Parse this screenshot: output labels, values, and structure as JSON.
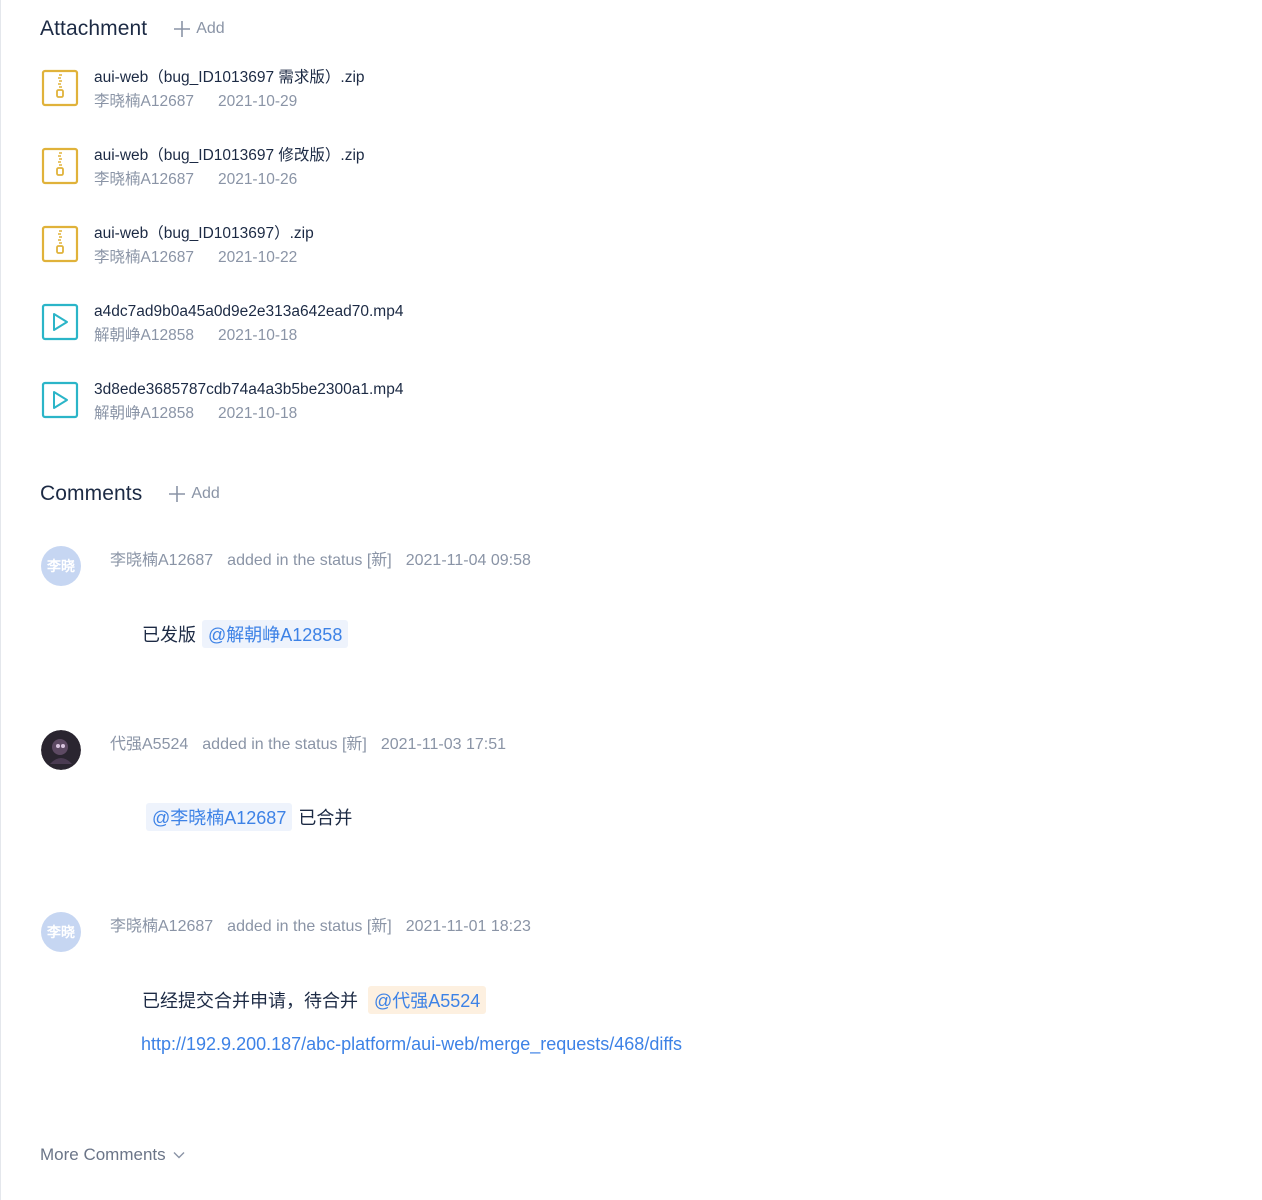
{
  "attachment": {
    "title": "Attachment",
    "add_label": "Add",
    "files": [
      {
        "name": "aui-web（bug_ID1013697 需求版）.zip",
        "author": "李晓楠A12687",
        "date": "2021-10-29",
        "type": "zip-icon"
      },
      {
        "name": "aui-web（bug_ID1013697 修改版）.zip",
        "author": "李晓楠A12687",
        "date": "2021-10-26",
        "type": "zip-icon"
      },
      {
        "name": "aui-web（bug_ID1013697）.zip",
        "author": "李晓楠A12687",
        "date": "2021-10-22",
        "type": "zip-icon"
      },
      {
        "name": "a4dc7ad9b0a45a0d9e2e313a642ead70.mp4",
        "author": "解朝峥A12858",
        "date": "2021-10-18",
        "type": "video-icon"
      },
      {
        "name": "3d8ede3685787cdb74a4a3b5be2300a1.mp4",
        "author": "解朝峥A12858",
        "date": "2021-10-18",
        "type": "video-icon"
      }
    ]
  },
  "comments": {
    "title": "Comments",
    "add_label": "Add",
    "items": [
      {
        "avatar_text": "李晓",
        "author": "李晓楠A12687",
        "status": "added in the status [新]",
        "time": "2021-11-04 09:58",
        "text_before": "已发版",
        "mention": "@解朝峥A12858",
        "text_after": ""
      },
      {
        "avatar_text": "",
        "author": "代强A5524",
        "status": "added in the status [新]",
        "time": "2021-11-03 17:51",
        "text_before": "",
        "mention": "@李晓楠A12687",
        "text_after": "已合并"
      },
      {
        "avatar_text": "李晓",
        "author": "李晓楠A12687",
        "status": "added in the status [新]",
        "time": "2021-11-01 18:23",
        "text_before": "已经提交合并申请，待合并",
        "mention": "@代强A5524",
        "text_after": "",
        "link": "http://192.9.200.187/abc-platform/aui-web/merge_requests/468/diffs"
      }
    ],
    "more_label": "More Comments"
  },
  "colors": {
    "zip_icon": "#e0b23a",
    "video_icon": "#2bb5c8",
    "link": "#3d82e6",
    "avatar_bg": "#c6d6f2"
  }
}
